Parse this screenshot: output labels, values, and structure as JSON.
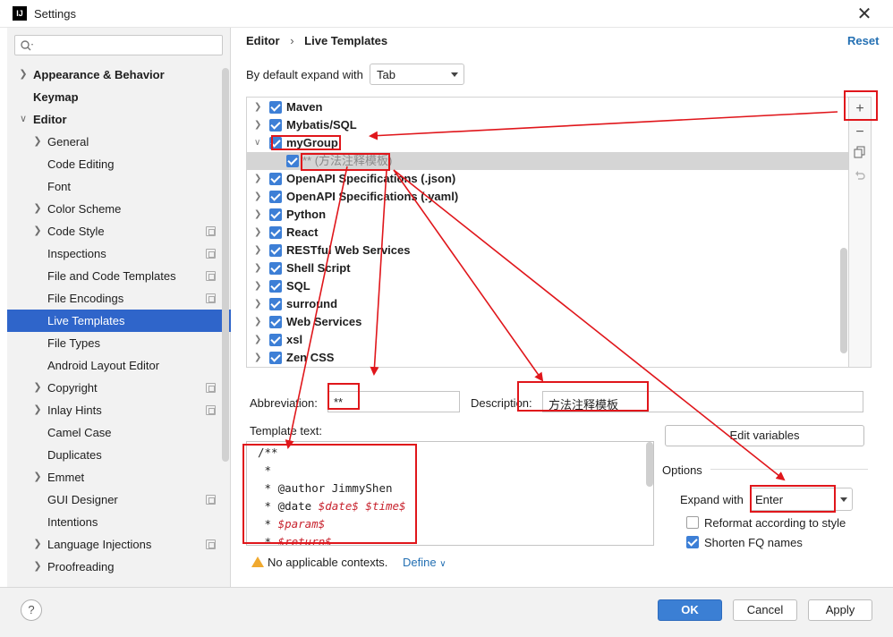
{
  "window": {
    "title": "Settings",
    "app_icon": "intellij-icon"
  },
  "search": {
    "placeholder": ""
  },
  "sidebar": {
    "items": [
      {
        "label": "Appearance & Behavior"
      },
      {
        "label": "Keymap"
      },
      {
        "label": "Editor"
      },
      {
        "label": "General"
      },
      {
        "label": "Code Editing"
      },
      {
        "label": "Font"
      },
      {
        "label": "Color Scheme"
      },
      {
        "label": "Code Style"
      },
      {
        "label": "Inspections"
      },
      {
        "label": "File and Code Templates"
      },
      {
        "label": "File Encodings"
      },
      {
        "label": "Live Templates"
      },
      {
        "label": "File Types"
      },
      {
        "label": "Android Layout Editor"
      },
      {
        "label": "Copyright"
      },
      {
        "label": "Inlay Hints"
      },
      {
        "label": "Camel Case"
      },
      {
        "label": "Duplicates"
      },
      {
        "label": "Emmet"
      },
      {
        "label": "GUI Designer"
      },
      {
        "label": "Intentions"
      },
      {
        "label": "Language Injections"
      },
      {
        "label": "Proofreading"
      }
    ]
  },
  "breadcrumb": {
    "parent": "Editor",
    "separator": "›",
    "current": "Live Templates"
  },
  "reset_label": "Reset",
  "expand": {
    "label": "By default expand with",
    "value": "Tab"
  },
  "tree": {
    "rows": [
      {
        "label": "Maven"
      },
      {
        "label": "Mybatis/SQL"
      },
      {
        "label": "myGroup"
      },
      {
        "label": "** (方法注释模板)"
      },
      {
        "label": "OpenAPI Specifications (.json)"
      },
      {
        "label": "OpenAPI Specifications (.yaml)"
      },
      {
        "label": "Python"
      },
      {
        "label": "React"
      },
      {
        "label": "RESTful Web Services"
      },
      {
        "label": "Shell Script"
      },
      {
        "label": "SQL"
      },
      {
        "label": "surround"
      },
      {
        "label": "Web Services"
      },
      {
        "label": "xsl"
      },
      {
        "label": "Zen CSS"
      }
    ]
  },
  "toolbar": {
    "add": "+",
    "remove": "−",
    "copy_icon": "copy-icon",
    "revert_icon": "revert-icon"
  },
  "abbreviation": {
    "label": "Abbreviation:",
    "value": "**"
  },
  "description": {
    "label": "Description:",
    "value": "方法注释模板"
  },
  "template": {
    "label": "Template text:",
    "lines": [
      {
        "text": "/**"
      },
      {
        "text": " *"
      },
      {
        "text": " * @author JimmyShen"
      },
      {
        "pre": " * @date ",
        "var1": "$date$",
        "mid": " ",
        "var2": "$time$"
      },
      {
        "pre": " * ",
        "var1": "$param$"
      },
      {
        "pre": " * ",
        "var1": "$return$"
      }
    ]
  },
  "edit_variables_label": "Edit variables",
  "options": {
    "label": "Options",
    "expand_label": "Expand with",
    "expand_value": "Enter",
    "reformat_label": "Reformat according to style",
    "reformat_checked": false,
    "shorten_label": "Shorten FQ names",
    "shorten_checked": true
  },
  "contexts": {
    "warning": "No applicable contexts.",
    "define": "Define"
  },
  "buttons": {
    "help": "?",
    "ok": "OK",
    "cancel": "Cancel",
    "apply": "Apply"
  },
  "colors": {
    "accent": "#2f65ca",
    "annotation": "#e0161b",
    "checkbox": "#3d7fd6",
    "variable": "#c7222d"
  }
}
